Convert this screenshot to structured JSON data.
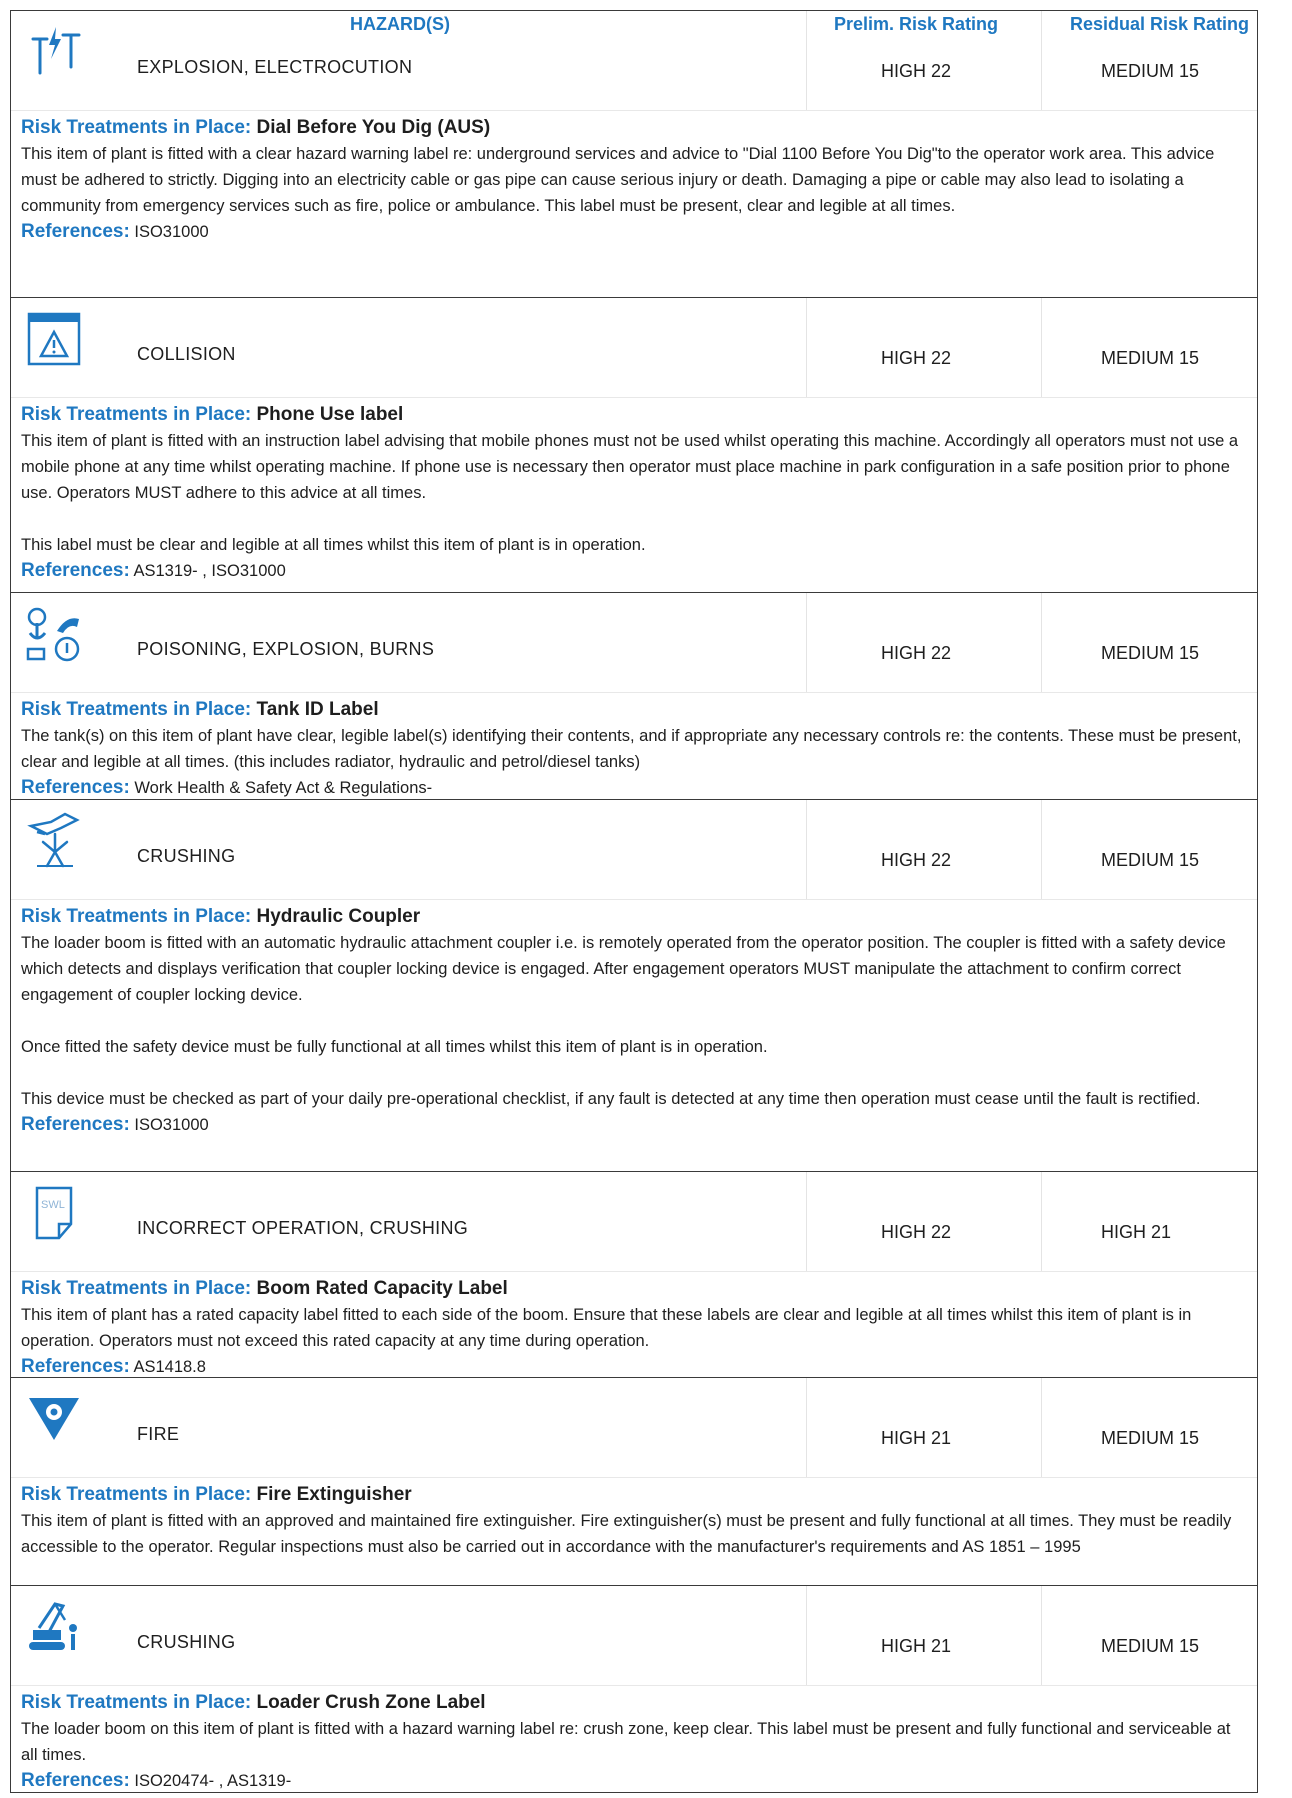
{
  "header": {
    "hazards": "HAZARD(S)",
    "prelim": "Prelim. Risk Rating",
    "residual": "Residual Risk Rating"
  },
  "labels": {
    "risk_treatments": "Risk Treatments in Place:",
    "references": "References:"
  },
  "colors": {
    "accent": "#1f78c1",
    "border": "#3a3a3a"
  },
  "sections": [
    {
      "icon": "power-line-icon",
      "hazard": "EXPLOSION, ELECTROCUTION",
      "prelim": "HIGH 22",
      "residual": "MEDIUM 15",
      "treatment": "Dial Before You Dig (AUS)",
      "paragraphs": [
        "This item of plant is fitted with a clear hazard warning label re: underground services and advice to \"Dial 1100 Before You Dig\"to the operator work area. This advice must be adhered to strictly. Digging into an electricity cable or gas pipe can cause serious injury or death. Damaging a pipe or cable may also lead to isolating a community from emergency services such as fire, police or ambulance. This label must be present, clear and legible at all times."
      ],
      "references": "ISO31000"
    },
    {
      "icon": "warning-screen-icon",
      "hazard": "COLLISION",
      "prelim": "HIGH 22",
      "residual": "MEDIUM 15",
      "treatment": "Phone Use label",
      "paragraphs": [
        "This item of plant is fitted with an instruction label advising that mobile phones must not be used whilst operating this machine. Accordingly all operators must not use a mobile phone at any time whilst operating machine. If phone use is necessary then operator must place machine in park configuration in a safe position prior to phone use. Operators MUST adhere to this advice at all times.",
        "This label must be clear and legible at all times whilst this item of plant is in operation."
      ],
      "references": "AS1319- , ISO31000"
    },
    {
      "icon": "tank-gauge-icon",
      "hazard": "POISONING, EXPLOSION, BURNS",
      "prelim": "HIGH 22",
      "residual": "MEDIUM 15",
      "treatment": "Tank ID Label",
      "paragraphs": [
        "The tank(s) on this item of plant have clear, legible label(s) identifying their contents, and if appropriate any necessary controls re: the contents. These must be present, clear and legible at all times. (this includes radiator, hydraulic and petrol/diesel tanks)"
      ],
      "references": "Work Health & Safety Act & Regulations-"
    },
    {
      "icon": "crush-hand-icon",
      "hazard": "CRUSHING",
      "prelim": "HIGH 22",
      "residual": "MEDIUM 15",
      "treatment": "Hydraulic Coupler",
      "paragraphs": [
        "The loader boom is fitted with an automatic hydraulic attachment coupler i.e. is remotely operated from the operator position. The coupler is fitted with a safety device which detects and displays verification that coupler locking device is engaged. After engagement operators MUST manipulate the attachment to confirm correct engagement of coupler locking device.",
        "Once fitted the safety device must be fully functional at all times whilst this item of plant is in operation.",
        "This device must be checked as part of your daily pre-operational checklist, if any fault is detected at any time then operation must cease until the fault is rectified."
      ],
      "references": "ISO31000"
    },
    {
      "icon": "swl-document-icon",
      "icon_text": "SWL",
      "hazard": "INCORRECT OPERATION, CRUSHING",
      "prelim": "HIGH 22",
      "residual": "HIGH 21",
      "treatment": "Boom Rated Capacity Label",
      "paragraphs": [
        "This item of plant has a rated capacity label fitted to each side of the boom. Ensure that these labels are clear and legible at all times whilst this item of plant is in operation. Operators must not exceed this rated capacity at any time during operation."
      ],
      "references": "AS1418.8"
    },
    {
      "icon": "fire-triangle-icon",
      "hazard": "FIRE",
      "prelim": "HIGH 21",
      "residual": "MEDIUM 15",
      "treatment": "Fire Extinguisher",
      "paragraphs": [
        "This item of plant is fitted with an approved and maintained fire extinguisher. Fire extinguisher(s) must be present and fully functional at all times. They must be readily accessible to the operator. Regular inspections must also be carried out in accordance with the manufacturer's requirements and AS 1851 – 1995"
      ],
      "references": ""
    },
    {
      "icon": "excavator-person-icon",
      "hazard": "CRUSHING",
      "prelim": "HIGH 21",
      "residual": "MEDIUM 15",
      "treatment": "Loader Crush Zone Label",
      "paragraphs": [
        "The loader boom on this item of plant is fitted with a hazard warning label re: crush zone, keep clear. This label must be present and fully functional and serviceable at all times."
      ],
      "references": "ISO20474- , AS1319-"
    }
  ]
}
